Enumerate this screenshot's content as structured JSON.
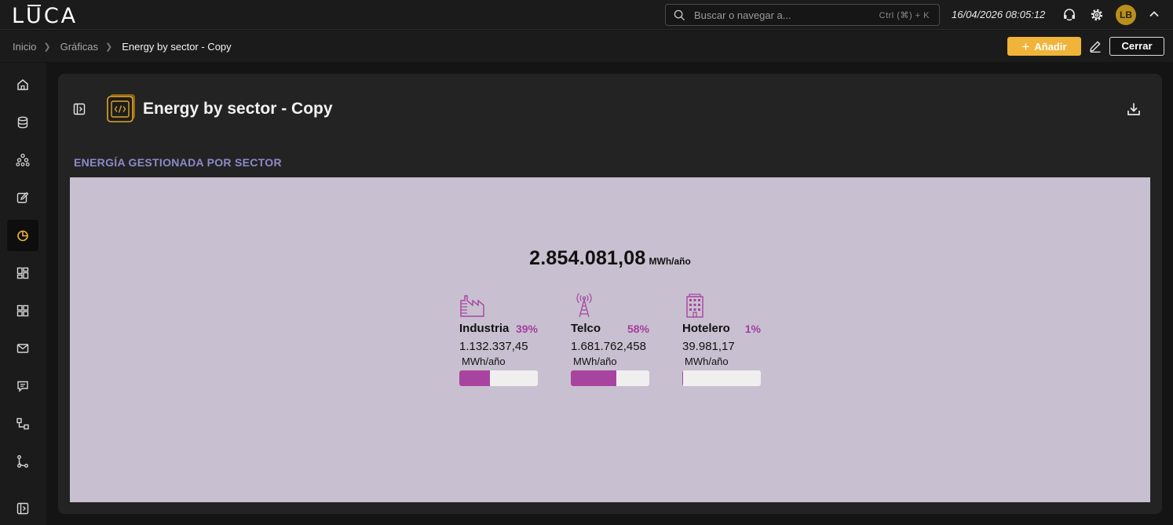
{
  "app": {
    "logo_text_pre": "L",
    "logo_text_u": "U",
    "logo_text_post": "CA"
  },
  "search": {
    "placeholder": "Buscar o navegar a...",
    "shortcut": "Ctrl (⌘) + K"
  },
  "header": {
    "datetime": "16/04/2026 08:05:12",
    "avatar_initials": "LB"
  },
  "breadcrumb": {
    "items": [
      "Inicio",
      "Gráficas"
    ],
    "current": "Energy by sector - Copy"
  },
  "toolbar": {
    "add_label": "Añadir",
    "close_label": "Cerrar"
  },
  "panel": {
    "title": "Energy by sector - Copy",
    "section_title": "ENERGÍA GESTIONADA POR SECTOR"
  },
  "widget": {
    "total_value": "2.854.081,08",
    "total_unit": "MWh/año",
    "sectors": [
      {
        "name": "Industria",
        "percent_label": "39%",
        "value": "1.132.337,45",
        "unit": "MWh/año",
        "fraction": 0.39
      },
      {
        "name": "Telco",
        "percent_label": "58%",
        "value": "1.681.762,458",
        "unit": "MWh/año",
        "fraction": 0.58
      },
      {
        "name": "Hotelero",
        "percent_label": "1%",
        "value": "39.981,17",
        "unit": "MWh/año",
        "fraction": 0.01
      }
    ]
  },
  "colors": {
    "accent": "#f0b43a",
    "bar_fill": "#a8449f",
    "percent": "#a23f9f",
    "section_title": "#8e89c9",
    "chart_bg": "#c8c0d0"
  },
  "icons": {
    "topbar": [
      "search-icon",
      "support-icon",
      "gear-icon",
      "chevron-up-icon"
    ],
    "sidebar": [
      "home-icon",
      "database-icon",
      "hierarchy-icon",
      "edit-icon",
      "pie-chart-icon",
      "dashboard-icon",
      "grid-icon",
      "mail-icon",
      "chat-icon",
      "workflow-icon",
      "branch-icon",
      "expand-sidebar-icon"
    ],
    "sectors": [
      "factory-icon",
      "antenna-icon",
      "building-icon"
    ]
  }
}
